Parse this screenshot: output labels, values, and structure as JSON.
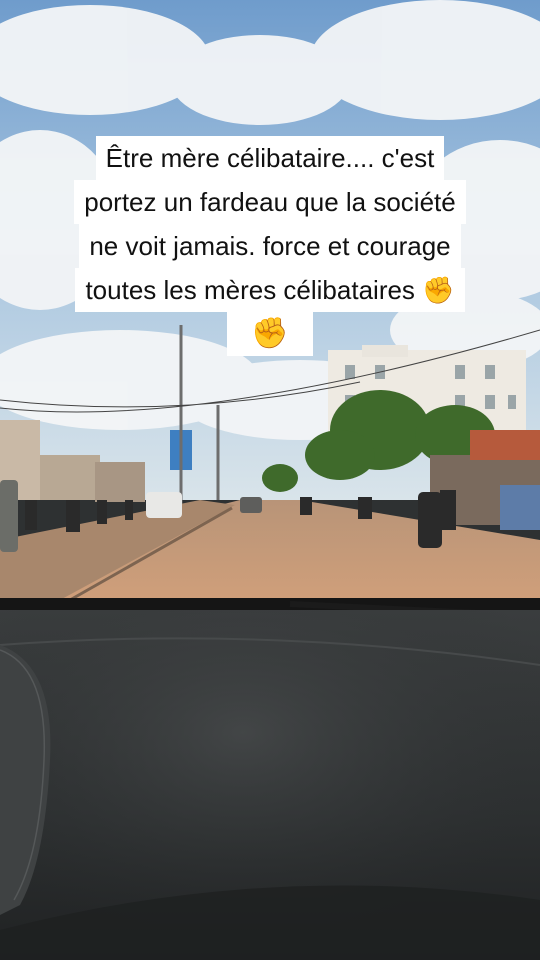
{
  "caption": {
    "lines": [
      "Être mère célibataire.... c'est",
      "portez un fardeau que la société",
      "ne voit jamais. force et courage",
      "toutes les mères célibataires ✊",
      "✊"
    ]
  },
  "colors": {
    "sky": "#8fb6d9",
    "road": "#c59a72",
    "dashboard": "#2f3233",
    "caption_bg": "#ffffff",
    "caption_text": "#111111"
  }
}
